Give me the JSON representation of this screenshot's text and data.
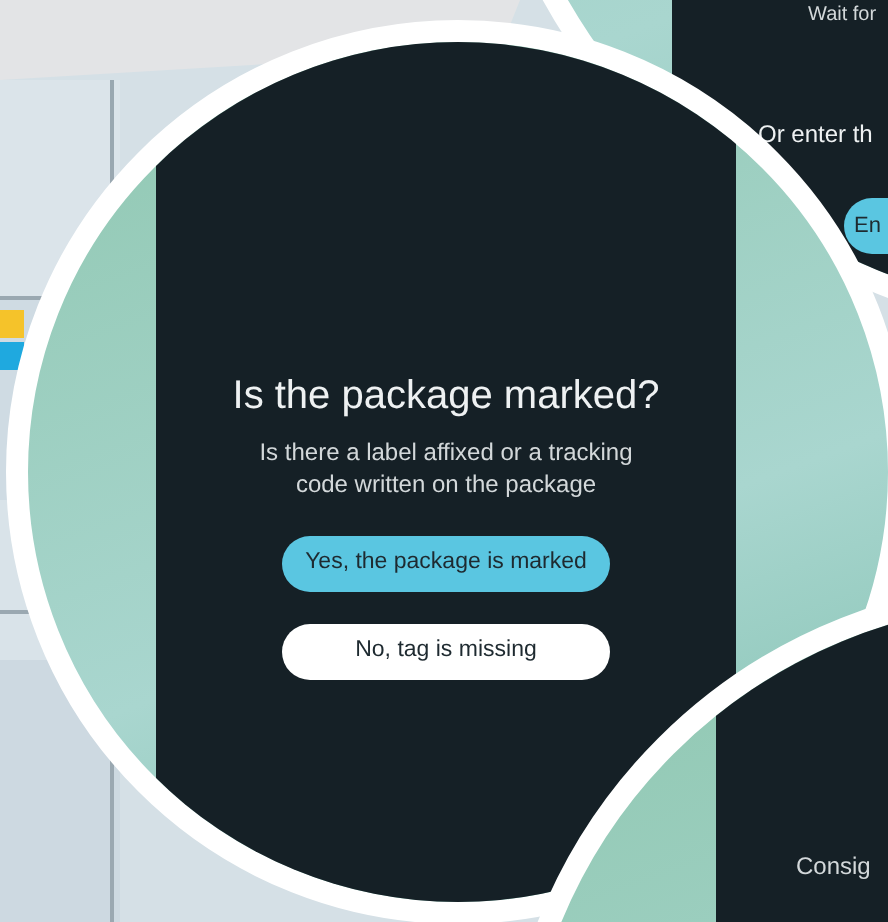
{
  "main_screen": {
    "title": "Is the package marked?",
    "subtitle": "Is there a label affixed or a tracking code written on the package",
    "buttons": [
      {
        "label": "Yes, the package is marked",
        "kind": "primary"
      },
      {
        "label": "No, tag is missing",
        "kind": "secondary"
      }
    ]
  },
  "top_right_screen": {
    "status_text": "Wait for",
    "prompt": "Or enter th",
    "button": {
      "label": "En",
      "kind": "primary"
    }
  },
  "bottom_right_screen": {
    "text": "Consig"
  }
}
